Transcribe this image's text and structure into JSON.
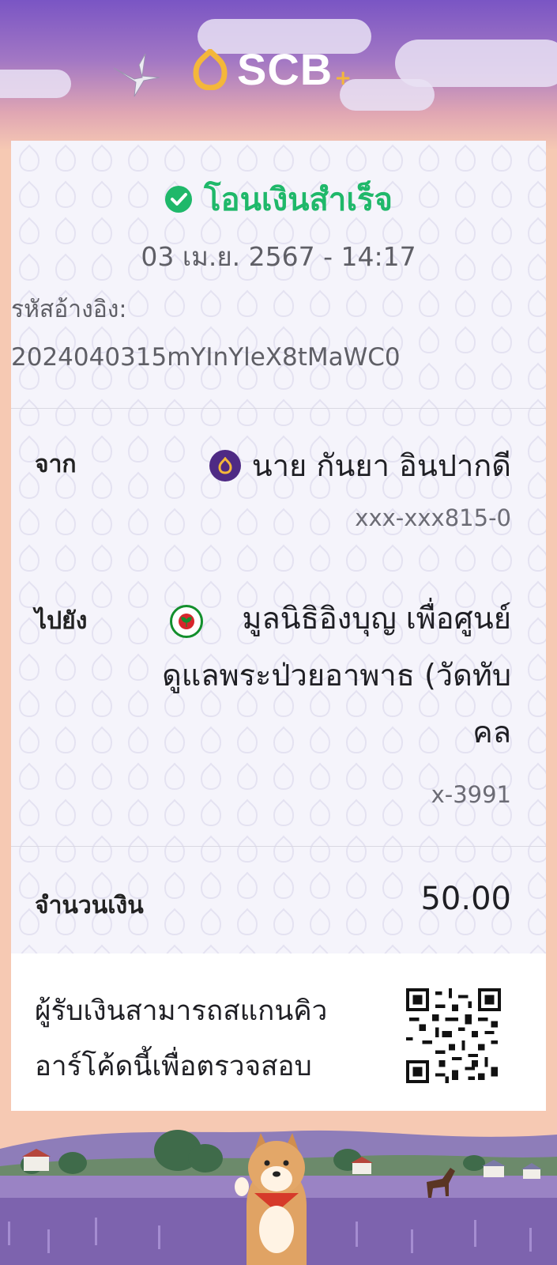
{
  "brand": {
    "name": "SCB",
    "plus": "+"
  },
  "status": {
    "text": "โอนเงินสำเร็จ",
    "color": "#1fb86a"
  },
  "datetime": "03 เม.ย. 2567 - 14:17",
  "reference": {
    "label": "รหัสอ้างอิง:",
    "value": "2024040315mYInYleX8tMaWC0"
  },
  "from": {
    "label": "จาก",
    "name": "นาย กันยา อินปากดี",
    "account": "xxx-xxx815-0",
    "bank_icon": "scb-bank-icon"
  },
  "to": {
    "label": "ไปยัง",
    "name_lines": [
      "มูลนิธิอิงบุญ เพื่อศูนย์",
      "ดูแลพระป่วยอาพาธ (วัดทับ",
      "คล"
    ],
    "account": "x-3991",
    "bank_icon": "kbank-icon"
  },
  "amount": {
    "label": "จำนวนเงิน",
    "value": "50.00"
  },
  "qr": {
    "lines": [
      "ผู้รับเงินสามารถสแกนคิว",
      "อาร์โค้ดนี้เพื่อตรวจสอบ"
    ]
  },
  "colors": {
    "brand_purple": "#4e2a84",
    "brand_gold": "#f4b73a",
    "kbank_green": "#138f2d"
  }
}
